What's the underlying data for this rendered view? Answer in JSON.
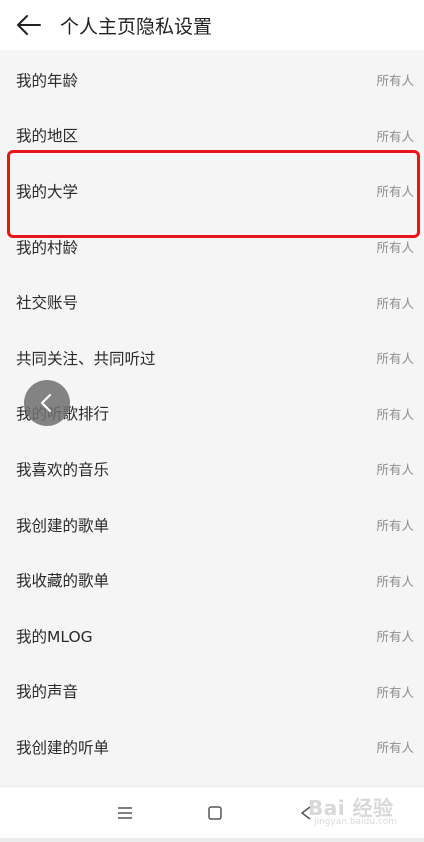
{
  "header": {
    "title": "个人主页隐私设置"
  },
  "settings": [
    {
      "label": "我的年龄",
      "value": "所有人"
    },
    {
      "label": "我的地区",
      "value": "所有人"
    },
    {
      "label": "我的大学",
      "value": "所有人"
    },
    {
      "label": "我的村龄",
      "value": "所有人"
    },
    {
      "label": "社交账号",
      "value": "所有人"
    },
    {
      "label": "共同关注、共同听过",
      "value": "所有人"
    },
    {
      "label": "我的听歌排行",
      "value": "所有人"
    },
    {
      "label": "我喜欢的音乐",
      "value": "所有人"
    },
    {
      "label": "我创建的歌单",
      "value": "所有人"
    },
    {
      "label": "我收藏的歌单",
      "value": "所有人"
    },
    {
      "label": "我的MLOG",
      "value": "所有人"
    },
    {
      "label": "我的声音",
      "value": "所有人"
    },
    {
      "label": "我创建的听单",
      "value": "所有人"
    }
  ],
  "highlight_color": "#e8141c",
  "watermark": {
    "main": "Bai 经验",
    "sub": "jingyan.baidu.com"
  },
  "icons": {
    "header_back": "arrow-left-icon",
    "floating_back": "chevron-left-icon",
    "nav_menu": "menu-icon",
    "nav_home": "square-home-icon",
    "nav_back": "triangle-back-icon"
  }
}
